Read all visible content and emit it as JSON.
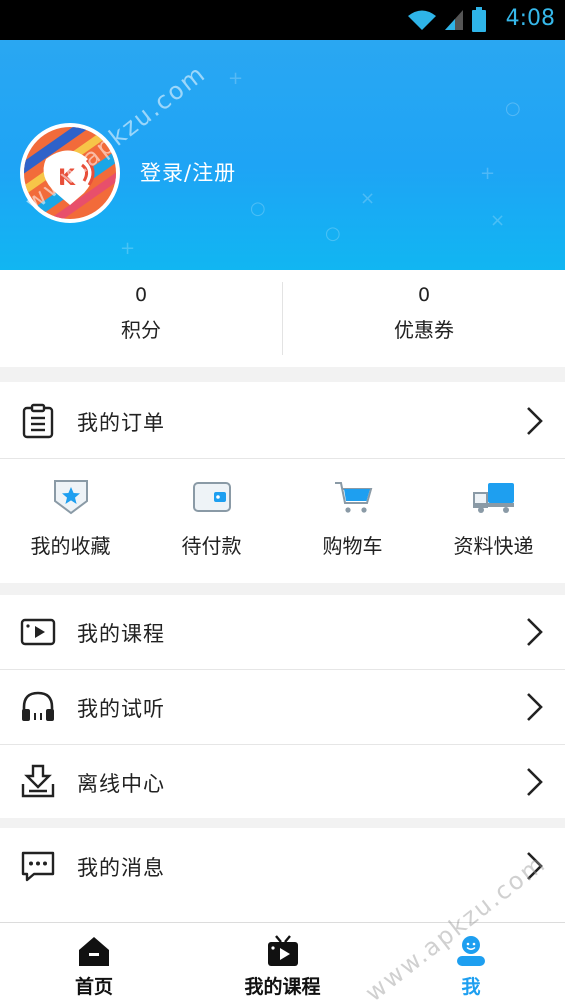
{
  "status_bar": {
    "time": "4:08"
  },
  "profile": {
    "login_label": "登录/注册"
  },
  "stats": [
    {
      "value": "0",
      "label": "积分"
    },
    {
      "value": "0",
      "label": "优惠券"
    }
  ],
  "orders": {
    "label": "我的订单"
  },
  "quick_actions": [
    {
      "label": "我的收藏",
      "icon": "favorite-shield-icon"
    },
    {
      "label": "待付款",
      "icon": "wallet-icon"
    },
    {
      "label": "购物车",
      "icon": "cart-icon"
    },
    {
      "label": "资料快递",
      "icon": "truck-icon"
    }
  ],
  "menu": [
    {
      "label": "我的课程",
      "icon": "video-icon"
    },
    {
      "label": "我的试听",
      "icon": "headphones-icon"
    },
    {
      "label": "离线中心",
      "icon": "download-icon"
    }
  ],
  "messages": {
    "label": "我的消息"
  },
  "tabs": [
    {
      "label": "首页",
      "icon": "home-icon"
    },
    {
      "label": "我的课程",
      "icon": "tv-icon"
    },
    {
      "label": "我",
      "icon": "user-icon"
    }
  ],
  "watermark": "www.apkzu.com",
  "colors": {
    "accent": "#1e9ff0",
    "header_top": "#2aa7f2",
    "header_bottom": "#11b6f2"
  }
}
